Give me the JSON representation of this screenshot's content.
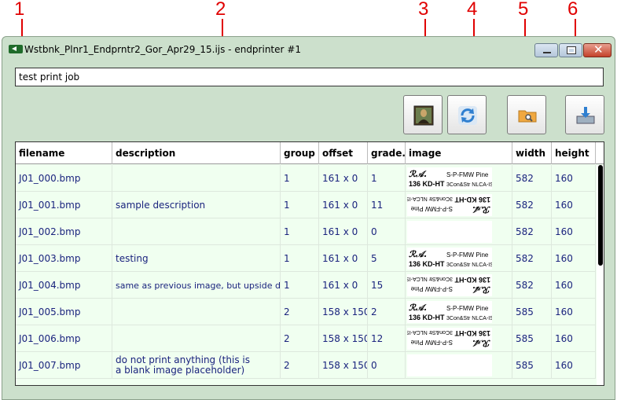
{
  "callouts": [
    "1",
    "2",
    "3",
    "4",
    "5",
    "6"
  ],
  "window": {
    "title": "Wstbnk_Plnr1_Endprntr2_Gor_Apr29_15.ijs - endprinter #1",
    "minimize_icon": "minimize-icon",
    "maximize_icon": "maximize-icon",
    "close_icon": "close-icon",
    "close_glyph": "✕"
  },
  "job_name": "test print job",
  "toolbar": {
    "buttons": [
      {
        "name": "image-button",
        "icon": "picture-icon"
      },
      {
        "name": "refresh-button",
        "icon": "refresh-icon"
      },
      {
        "name": "browse-folder-button",
        "icon": "folder-search-icon"
      },
      {
        "name": "export-button",
        "icon": "export-icon"
      }
    ]
  },
  "table": {
    "columns": [
      "filename",
      "description",
      "group",
      "offset",
      "grade...",
      "image",
      "width",
      "height"
    ],
    "rows": [
      {
        "filename": "J01_000.bmp",
        "description": "",
        "group": "1",
        "offset": "161 x 0",
        "grade": "1",
        "thumb": "normal",
        "width": "582",
        "height": "160"
      },
      {
        "filename": "J01_001.bmp",
        "description": "sample description",
        "group": "1",
        "offset": "161 x 0",
        "grade": "11",
        "thumb": "flipped",
        "width": "582",
        "height": "160"
      },
      {
        "filename": "J01_002.bmp",
        "description": "",
        "group": "1",
        "offset": "161 x 0",
        "grade": "0",
        "thumb": "blank",
        "width": "582",
        "height": "160"
      },
      {
        "filename": "J01_003.bmp",
        "description": "testing",
        "group": "1",
        "offset": "161 x 0",
        "grade": "5",
        "thumb": "normal",
        "width": "582",
        "height": "160"
      },
      {
        "filename": "J01_004.bmp",
        "description": "same as previous image, but upside down",
        "group": "1",
        "offset": "161 x 0",
        "grade": "15",
        "thumb": "flipped",
        "width": "582",
        "height": "160"
      },
      {
        "filename": "J01_005.bmp",
        "description": "",
        "group": "2",
        "offset": "158 x 150",
        "grade": "2",
        "thumb": "normal",
        "width": "585",
        "height": "160"
      },
      {
        "filename": "J01_006.bmp",
        "description": "",
        "group": "2",
        "offset": "158 x 150",
        "grade": "12",
        "thumb": "flipped",
        "width": "585",
        "height": "160"
      },
      {
        "filename": "J01_007.bmp",
        "description": "do not print anything (this is a blank image placeholder)",
        "group": "2",
        "offset": "158 x 150",
        "grade": "0",
        "thumb": "blank",
        "width": "585",
        "height": "160"
      }
    ]
  },
  "thumbnail_text": {
    "logo": "ℛ𝒜.",
    "line1_left": "136 KD-HT",
    "line1_right": "S-P-FMW Pine",
    "line2_right": "3Con&Str NLCA-IS"
  },
  "colors": {
    "window_bg": "#cce0cc",
    "row_bg": "#f0fff0",
    "text_blue": "#1a237e",
    "callout_red": "#e00000"
  }
}
